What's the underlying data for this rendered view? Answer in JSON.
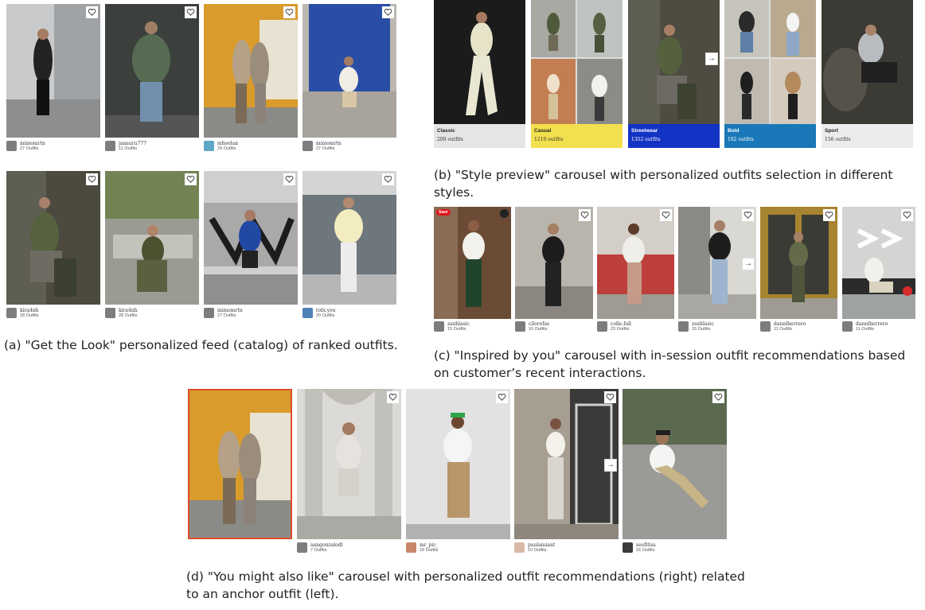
{
  "feed": {
    "rows": [
      [
        {
          "username": "mimomrtn",
          "count": "27 Outfits"
        },
        {
          "username": "janauru777",
          "count": "11 Outfits"
        },
        {
          "username": "mhoolan",
          "count": "29 Outfits"
        },
        {
          "username": "mimomrtn",
          "count": "27 Outfits"
        }
      ],
      [
        {
          "username": "kira4nh",
          "count": "28 Outfits"
        },
        {
          "username": "kira4nh",
          "count": "28 Outfits"
        },
        {
          "username": "mimomrtn",
          "count": "27 Outfits"
        },
        {
          "username": "tobi.you",
          "count": "20 Outfits"
        }
      ]
    ],
    "caption": "(a) \"Get the Look\" personalized feed (catalog) of ranked outfits."
  },
  "style_preview": {
    "styles": [
      {
        "name": "Classic",
        "count": "200 outfits",
        "color": "#e5e5e5",
        "text_color": "#222222"
      },
      {
        "name": "Casual",
        "count": "1210 outfits",
        "color": "#f3e04e",
        "text_color": "#222222"
      },
      {
        "name": "Streetwear",
        "count": "1352 outfits",
        "color": "#1233c4",
        "text_color": "#ffffff"
      },
      {
        "name": "Bold",
        "count": "182 outfits",
        "color": "#1a78b8",
        "text_color": "#ffffff"
      },
      {
        "name": "Sport",
        "count": "156 outfits",
        "color": "#ececec",
        "text_color": "#222222"
      }
    ],
    "caption": "(b) \"Style preview\" carousel with personalized outfits selection in different styles."
  },
  "inspired": {
    "badge": "Save",
    "items": [
      {
        "username": "zaxhlasic",
        "count": "15 Outfits"
      },
      {
        "username": "cilorefas",
        "count": "10 Outfits"
      },
      {
        "username": "colle.fall",
        "count": "23 Outfits"
      },
      {
        "username": "zaxhlasic",
        "count": "15 Outfits"
      },
      {
        "username": "dannlherrero",
        "count": "11 Outfits"
      },
      {
        "username": "dannlherrero",
        "count": "11 Outfits"
      }
    ],
    "caption": "(c) \"Inspired by you\" carousel with in-session outfit recommendations based on customer’s recent interactions."
  },
  "also_like": {
    "items": [
      {
        "username": "",
        "count": ""
      },
      {
        "username": "iamgonzalodl",
        "count": "7 Outfits"
      },
      {
        "username": "mr_pic_",
        "count": "18 Outfits"
      },
      {
        "username": "paulamiant",
        "count": "10 Outfits"
      },
      {
        "username": "seofitiss",
        "count": "16 Outfits"
      }
    ],
    "caption": "(d) \"You might also like\" carousel with personalized outfit recommendations (right) related to an anchor outfit (left)."
  },
  "icons": {
    "heart": "heart-icon",
    "arrow": "→",
    "arrow_name": "arrow-right-icon"
  },
  "colors": {
    "anchor_border": "#e04a2b",
    "save_badge": "#e1141c"
  }
}
